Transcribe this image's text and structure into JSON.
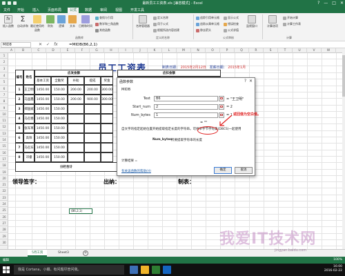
{
  "window": {
    "title": "最新员工工资表.xls [兼容模式] - Excel",
    "buttons": [
      "?",
      "—",
      "□",
      "✕"
    ]
  },
  "ribbon": {
    "tabs": [
      "文件",
      "开始",
      "插入",
      "页面布局",
      "公式",
      "数据",
      "审阅",
      "视图",
      "开发工具"
    ],
    "active_tab": "公式",
    "buttons": {
      "insert_function": "插入函数",
      "auto_sum": "自动求和",
      "recently_used": "最近使用的函数",
      "financial": "财务",
      "logical": "逻辑",
      "text": "文本",
      "datetime": "日期和时间",
      "lookup": "查找与引用",
      "math": "数学和三角函数",
      "other": "其他函数",
      "name_manager": "名称管理器",
      "define_name": "定义名称",
      "use_in_formula": "用于公式",
      "create_from_selection": "根据所选内容创建",
      "trace_precedents": "追踪引用单元格",
      "trace_dependents": "追踪从属单元格",
      "remove_arrows": "移去箭头",
      "show_formulas": "显示公式",
      "error_checking": "错误检查",
      "evaluate_formula": "公式求值",
      "watch_window": "监视窗口",
      "calc_options": "计算选项",
      "calc_now": "开始计算",
      "calc_sheet": "计算工作表"
    },
    "groups": {
      "function_library": "函数库",
      "defined_names": "定义的名称",
      "formula_auditing": "公式审核",
      "calculation": "计算"
    }
  },
  "formula_bar": {
    "name_box": "MID8",
    "icons": [
      "✕",
      "✓",
      "fx"
    ],
    "formula": "=MIDB(B6,2,1)"
  },
  "grid": {
    "columns": [
      "A",
      "B",
      "C",
      "D",
      "E",
      "F",
      "G",
      "H",
      "I",
      "J",
      "K",
      "L",
      "M",
      "N",
      "O",
      "P",
      "Q",
      "R",
      "S",
      "T",
      "U",
      "V",
      "W"
    ],
    "rows": [
      "1",
      "2",
      "3",
      "4",
      "5",
      "6",
      "7",
      "8",
      "9",
      "10",
      "11",
      "12",
      "13",
      "14",
      "15",
      "16",
      "17",
      "18",
      "19",
      "20",
      "21",
      "22",
      "23",
      "24",
      "25",
      "26",
      "27",
      "28",
      "29",
      "30"
    ]
  },
  "sheet": {
    "title": "员工工资表",
    "meta_label_1": "制表日期：",
    "meta_date_1": "2015年2月12日",
    "meta_label_2": "发薪日期：",
    "meta_date_2": "2015年1月",
    "headers": {
      "index": "编号",
      "name": "姓名",
      "payable": "应发金额",
      "deduction": "应扣金额",
      "base": "基本工资",
      "attendance": "全勤奖",
      "subsidy": "补助",
      "commission": "提成",
      "bonus": "奖金"
    },
    "employees": [
      {
        "id": "1",
        "name": "王卫明",
        "base": "1450.00",
        "att": "150.00",
        "sub": "200.00",
        "com": "200.00",
        "bon": "300.00"
      },
      {
        "id": "2",
        "name": "马国鑫",
        "base": "1450.00",
        "att": "150.00",
        "sub": "200.00",
        "com": "900.00",
        "bon": "300.00"
      },
      {
        "id": "3",
        "name": "郑国斌",
        "base": "1450.00",
        "att": "150.00",
        "sub": "",
        "com": "",
        "bon": ""
      },
      {
        "id": "4",
        "name": "马召春",
        "base": "1450.00",
        "att": "150.00",
        "sub": "",
        "com": "",
        "bon": ""
      },
      {
        "id": "5",
        "name": "张军草",
        "base": "1450.00",
        "att": "150.00",
        "sub": "",
        "com": "",
        "bon": ""
      },
      {
        "id": "6",
        "name": "高阳",
        "base": "1450.00",
        "att": "150.00",
        "sub": "",
        "com": "",
        "bon": ""
      },
      {
        "id": "7",
        "name": "马召东",
        "base": "1450.00",
        "att": "150.00",
        "sub": "",
        "com": "",
        "bon": ""
      },
      {
        "id": "8",
        "name": "邓睿",
        "base": "1450.00",
        "att": "150.00",
        "sub": "",
        "com": "",
        "bon": ""
      }
    ],
    "total_label": "分栏合计",
    "sign_leader": "领导签字：",
    "sign_cashier": "出纳：",
    "sign_maker": "制表：",
    "edit_cell": "(B6,2,1)"
  },
  "dialog": {
    "title": "函数参数",
    "help": "?",
    "close": "✕",
    "function_name": "MIDB",
    "args": [
      {
        "label": "Text",
        "value": "B6",
        "result": "= \"王卫明\""
      },
      {
        "label": "Start_num",
        "value": "2",
        "result": "= 2"
      },
      {
        "label": "Num_bytes",
        "value": "1",
        "result": "= 1"
      }
    ],
    "preview_result": "= \"\"",
    "description": "自文字的指定起始位置开始提取指定长度的字符串。可供单字节字符集(DBCS)一起使用",
    "arg_desc_name": "Num_bytes",
    "arg_desc": "所要提取字符串的长度",
    "calc_result": "计算结果 =",
    "help_link": "有关该函数的帮助(H)",
    "ok": "确定",
    "cancel": "取消"
  },
  "annotation": {
    "text": "返回值为空白值。",
    "color": "#e02020"
  },
  "sheet_tabs": [
    "5月工资",
    "Sheet3"
  ],
  "add_sheet": "+",
  "status": {
    "mode": "编辑",
    "zoom": "100%"
  },
  "taskbar": {
    "search": "我是 Cortana，小娜。有问题尽管问我。",
    "time": "16:00",
    "date": "2016-02-22"
  },
  "watermark": {
    "text": "我爱IT技术网",
    "sub": "jingyan.baidu.com"
  },
  "colors": {
    "excel_green": "#217346",
    "title_blue": "#1f3a93",
    "annotation_red": "#e02020"
  }
}
